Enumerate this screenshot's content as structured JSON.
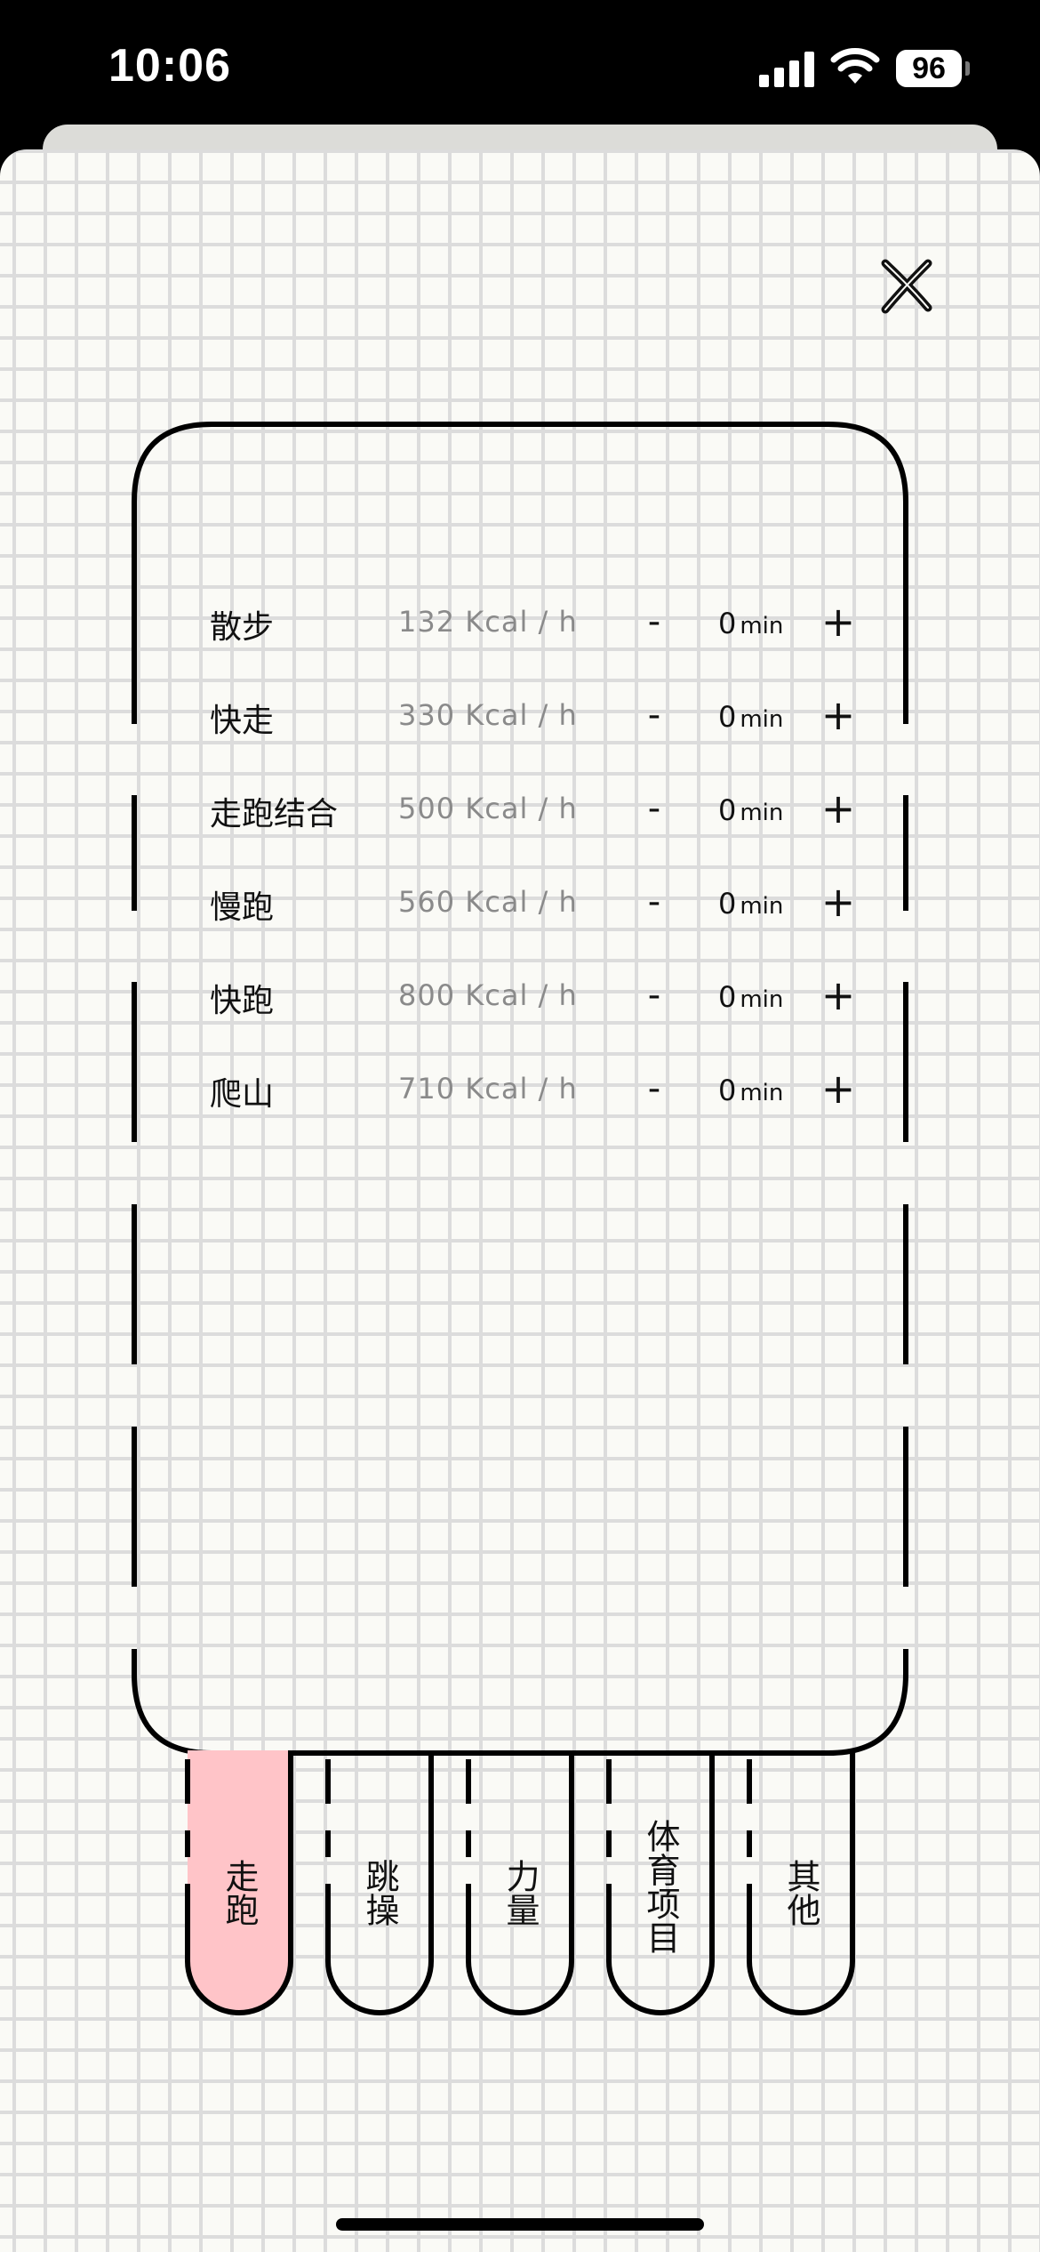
{
  "status_bar": {
    "time": "10:06",
    "battery": "96"
  },
  "activities": [
    {
      "name": "散步",
      "kcal": "132 Kcal / h",
      "minus": "-",
      "minutes": "0",
      "unit": "min",
      "plus": "+"
    },
    {
      "name": "快走",
      "kcal": "330 Kcal / h",
      "minus": "-",
      "minutes": "0",
      "unit": "min",
      "plus": "+"
    },
    {
      "name": "走跑结合",
      "kcal": "500 Kcal / h",
      "minus": "-",
      "minutes": "0",
      "unit": "min",
      "plus": "+"
    },
    {
      "name": "慢跑",
      "kcal": "560 Kcal / h",
      "minus": "-",
      "minutes": "0",
      "unit": "min",
      "plus": "+"
    },
    {
      "name": "快跑",
      "kcal": "800 Kcal / h",
      "minus": "-",
      "minutes": "0",
      "unit": "min",
      "plus": "+"
    },
    {
      "name": "爬山",
      "kcal": "710 Kcal / h",
      "minus": "-",
      "minutes": "0",
      "unit": "min",
      "plus": "+"
    }
  ],
  "tabs": [
    {
      "label": "走跑",
      "active": true
    },
    {
      "label": "跳操",
      "active": false
    },
    {
      "label": "力量",
      "active": false
    },
    {
      "label": "体育项目",
      "active": false
    },
    {
      "label": "其他",
      "active": false
    }
  ],
  "colors": {
    "active_tab": "#ffc4c8",
    "ink": "#111111",
    "kcal_text": "#8a8a8a",
    "grid": "#dcdcdc",
    "paper": "#fafaf6"
  },
  "icons": {
    "close": "close-x-icon",
    "signal": "signal-icon",
    "wifi": "wifi-icon",
    "battery": "battery-icon"
  }
}
